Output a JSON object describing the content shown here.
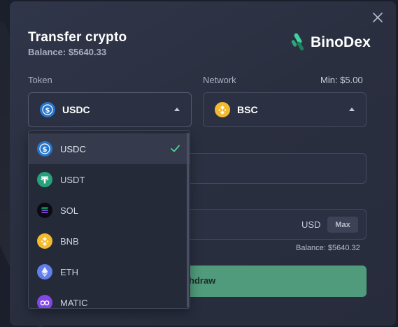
{
  "modal": {
    "title": "Transfer crypto",
    "balance_label": "Balance:",
    "balance_value": "$5640.33",
    "brand": "BinoDex"
  },
  "token": {
    "label": "Token",
    "selected": "USDC",
    "options": [
      {
        "label": "USDC",
        "icon": "usdc-coin-icon",
        "selected": true
      },
      {
        "label": "USDT",
        "icon": "usdt-coin-icon",
        "selected": false
      },
      {
        "label": "SOL",
        "icon": "sol-coin-icon",
        "selected": false
      },
      {
        "label": "BNB",
        "icon": "bnb-coin-icon",
        "selected": false
      },
      {
        "label": "ETH",
        "icon": "eth-coin-icon",
        "selected": false
      },
      {
        "label": "MATIC",
        "icon": "matic-coin-icon",
        "selected": false
      }
    ]
  },
  "network": {
    "label": "Network",
    "min": "Min: $5.00",
    "selected": "BSC"
  },
  "amount": {
    "currency": "USD",
    "max_label": "Max",
    "balance": "Balance: $5640.32"
  },
  "withdraw": {
    "label_partial": "hdraw"
  },
  "colors": {
    "background": "#2a2f40",
    "accent_green": "#4f9b7b",
    "usdc": "#2775ca",
    "usdt": "#26a17b",
    "bnb": "#f3ba2f",
    "eth": "#627eea",
    "matic": "#8247e5"
  }
}
